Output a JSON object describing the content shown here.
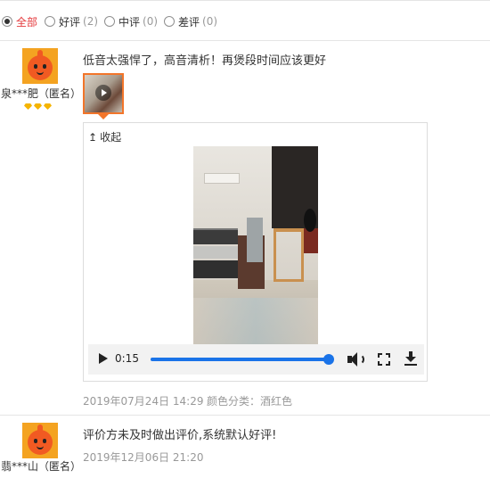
{
  "filters": [
    {
      "label": "全部",
      "count": "",
      "active": true
    },
    {
      "label": "好评",
      "count": "(2)",
      "active": false
    },
    {
      "label": "中评",
      "count": "(0)",
      "active": false
    },
    {
      "label": "差评",
      "count": "(0)",
      "active": false
    }
  ],
  "reviews": [
    {
      "username": "泉***肥（匿名）",
      "text": "低音太强悍了，高音清析！再煲段时间应该更好",
      "collapse_label": "收起",
      "video": {
        "time": "0:15",
        "progress": 1.0
      },
      "date": "2019年07月24日 14:29",
      "attribute": "颜色分类：酒红色"
    },
    {
      "username": "翡***山（匿名）",
      "text": "评价方未及时做出评价,系统默认好评!",
      "date": "2019年12月06日 21:20"
    }
  ],
  "colors": {
    "active": "#e4393c",
    "accent": "#f2752a",
    "progress": "#1a73e8"
  }
}
